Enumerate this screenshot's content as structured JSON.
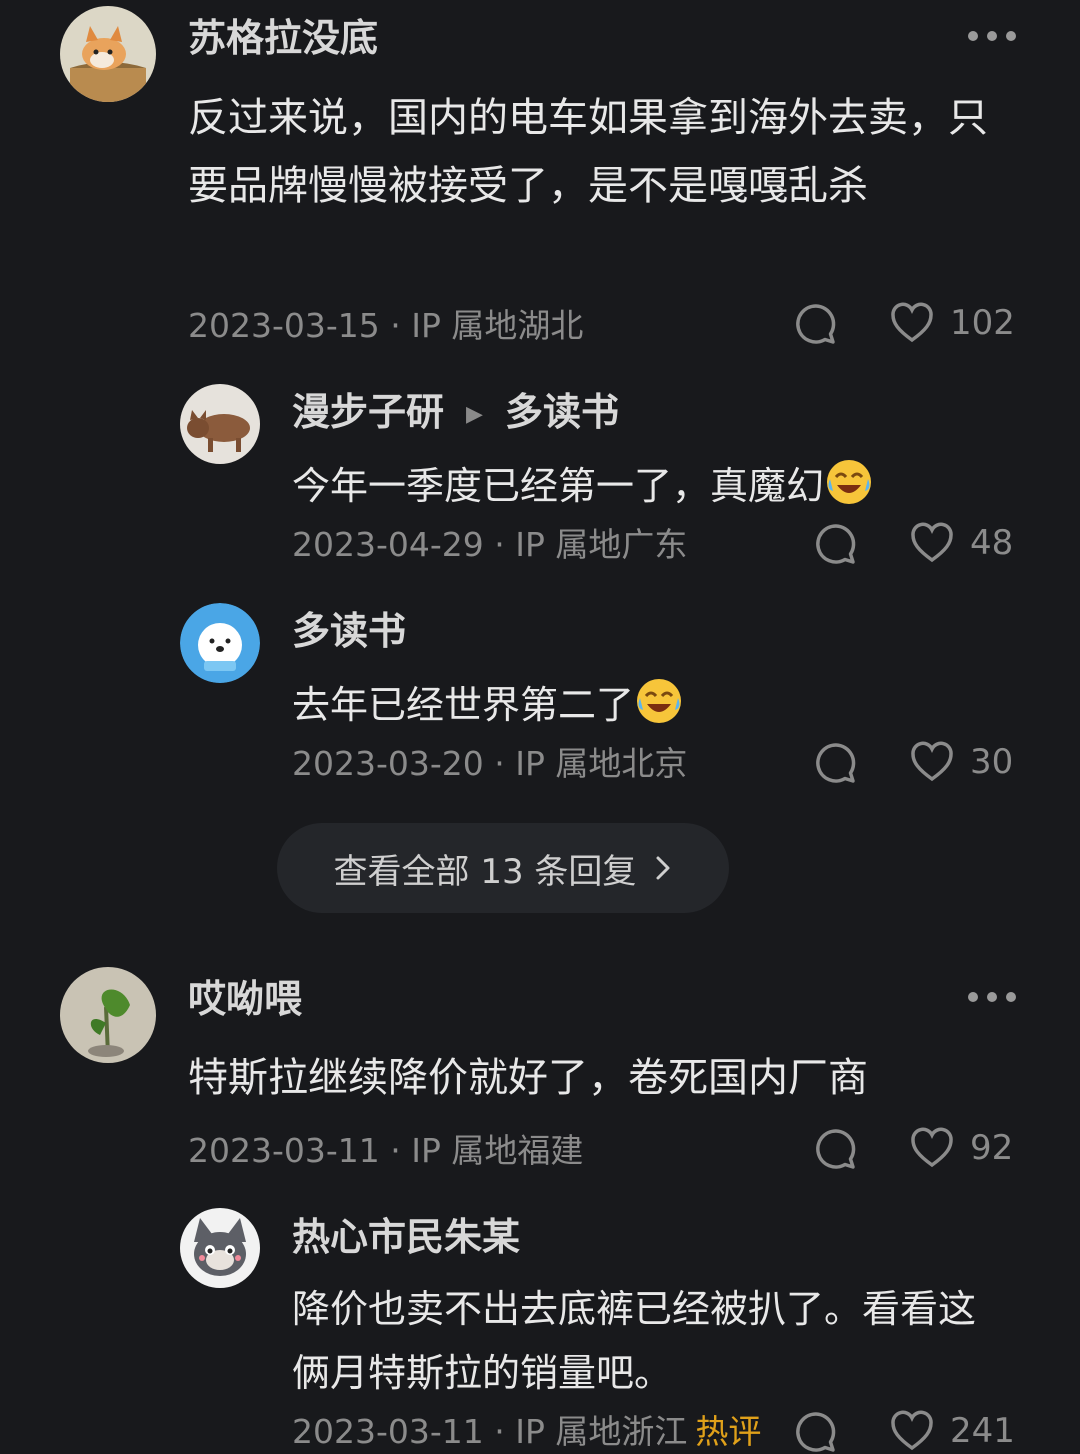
{
  "comments": [
    {
      "user": "苏格拉没底",
      "text": "反过来说，国内的电车如果拿到海外去卖，只要品牌慢慢被接受了，是不是嘎嘎乱杀",
      "meta": "2023-03-15 · IP 属地湖北",
      "likes": "102",
      "avatar_icon": "corgi-avatar-icon"
    },
    {
      "user": "哎呦喂",
      "text": "特斯拉继续降价就好了，卷死国内厂商",
      "meta": "2023-03-11 · IP 属地福建",
      "likes": "92",
      "avatar_icon": "plant-avatar-icon"
    }
  ],
  "replies": [
    {
      "user": "漫步子研",
      "reply_to": "多读书",
      "text": "今年一季度已经第一了，真魔幻",
      "meta": "2023-04-29 · IP 属地广东",
      "likes": "48",
      "emoji": "cry-laugh-emoji"
    },
    {
      "user": "多读书",
      "text": "去年已经世界第二了",
      "meta": "2023-03-20 · IP 属地北京",
      "likes": "30",
      "emoji": "cry-laugh-emoji"
    },
    {
      "user": "热心市民朱某",
      "text": "降价也卖不出去底裤已经被扒了。看看这俩月特斯拉的销量吧。",
      "meta": "2023-03-11 · IP 属地浙江",
      "hot_badge": "热评",
      "likes": "241"
    }
  ],
  "view_all": "查看全部 13 条回复",
  "colors": {
    "background": "#18191c",
    "hot": "#e0a11a",
    "text": "#e8e8e8",
    "muted": "#8b8b8b"
  }
}
